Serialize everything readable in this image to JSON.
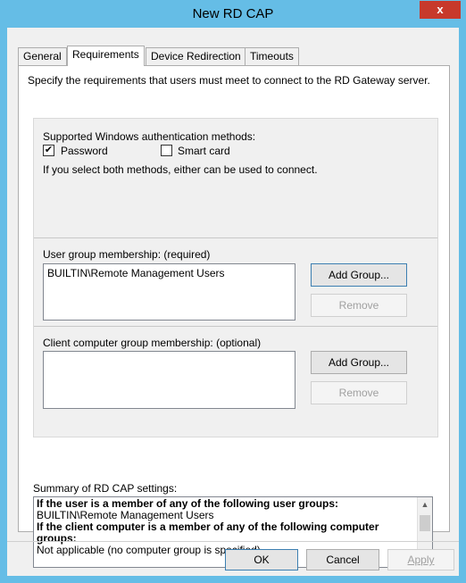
{
  "window": {
    "title": "New RD CAP",
    "close": "x"
  },
  "tabs": [
    {
      "label": "General"
    },
    {
      "label": "Requirements"
    },
    {
      "label": "Device Redirection"
    },
    {
      "label": "Timeouts"
    }
  ],
  "requirements": {
    "description": "Specify the requirements that users must meet to connect to the RD Gateway server.",
    "auth_heading": "Supported Windows authentication methods:",
    "password": {
      "label": "Password",
      "checked": "✔"
    },
    "smartcard": {
      "label": "Smart card"
    },
    "both_note": "If you select both methods, either can be used to connect.",
    "user_group_label": "User group membership: (required)",
    "user_groups": [
      "BUILTIN\\Remote Management Users"
    ],
    "add_group_label": "Add Group...",
    "remove_label": "Remove",
    "client_group_label": "Client computer group membership: (optional)"
  },
  "summary": {
    "label": "Summary of RD CAP settings:",
    "line1": "If the user is a member of any of the following user groups:",
    "line2": "BUILTIN\\Remote Management Users",
    "line3": "If the client computer is a member of any of the following computer groups:",
    "line4": "Not applicable (no computer group is specified)"
  },
  "footer": {
    "ok": "OK",
    "cancel": "Cancel",
    "apply": "Apply"
  },
  "icons": {
    "up": "▲",
    "down": "▼"
  }
}
